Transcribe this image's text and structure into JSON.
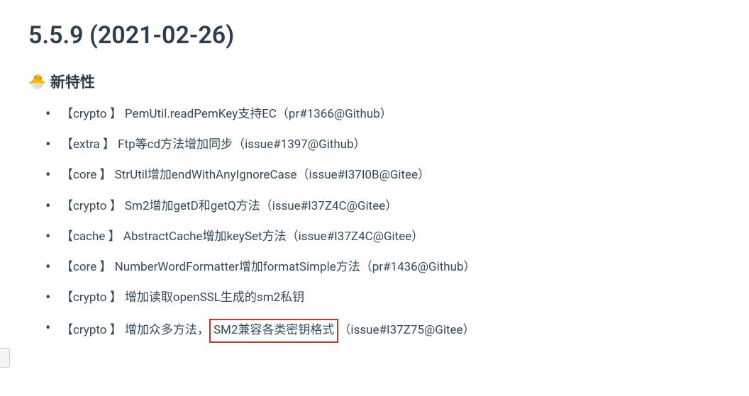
{
  "heading": "5.5.9 (2021-02-26)",
  "section": {
    "icon": "🐣",
    "title": "新特性"
  },
  "items": [
    {
      "module": "【crypto 】",
      "text": " PemUtil.readPemKey支持EC（pr#1366@Github）"
    },
    {
      "module": "【extra 】",
      "text": " Ftp等cd方法增加同步（issue#1397@Github）"
    },
    {
      "module": "【core 】",
      "text": " StrUtil增加endWithAnyIgnoreCase（issue#I37I0B@Gitee）"
    },
    {
      "module": "【crypto 】",
      "text": " Sm2增加getD和getQ方法（issue#I37Z4C@Gitee）"
    },
    {
      "module": "【cache 】",
      "text": " AbstractCache增加keySet方法（issue#I37Z4C@Gitee）"
    },
    {
      "module": "【core 】",
      "text": " NumberWordFormatter增加formatSimple方法（pr#1436@Github）"
    },
    {
      "module": "【crypto 】",
      "text": " 增加读取openSSL生成的sm2私钥"
    },
    {
      "module": "【crypto 】",
      "prefix": " 增加众多方法，",
      "highlight": "SM2兼容各类密钥格式",
      "suffix": "（issue#I37Z75@Gitee）"
    }
  ]
}
